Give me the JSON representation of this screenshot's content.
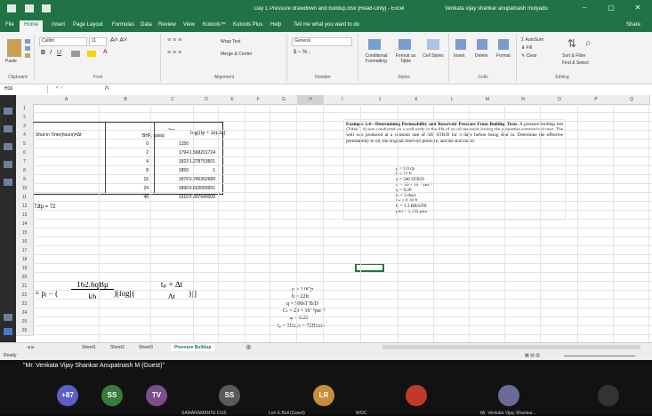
{
  "app": {
    "title": "Day 1 Pressure drawdown and buildup.xlsx [Read-Only] - Excel",
    "user": "Venkata vijay shankar anupatnash mulyadu"
  },
  "ribbon_tabs": [
    "File",
    "Home",
    "Insert",
    "Page Layout",
    "Formulas",
    "Data",
    "Review",
    "View",
    "Kutools™",
    "Kutools Plus",
    "Help",
    "Tell me what you want to do"
  ],
  "share": "Share",
  "ribbon": {
    "clipboard": {
      "label": "Clipboard",
      "paste": "Paste"
    },
    "font": {
      "label": "Font",
      "name": "Calibri",
      "size": "11"
    },
    "alignment": {
      "label": "Alignment",
      "wrap": "Wrap Text",
      "merge": "Merge & Center"
    },
    "number": {
      "label": "Number",
      "format": "General"
    },
    "styles": {
      "label": "Styles",
      "cond": "Conditional Formatting",
      "table": "Format as Table",
      "cell": "Cell Styles"
    },
    "cells": {
      "label": "Cells",
      "insert": "Insert",
      "delete": "Delete",
      "format": "Format"
    },
    "editing": {
      "label": "Editing",
      "autosum": "AutoSum",
      "fill": "Fill",
      "clear": "Clear",
      "sort": "Sort & Filter",
      "find": "Find & Select"
    }
  },
  "formula_bar": {
    "name_box": "H16",
    "fx": "fx"
  },
  "columns": [
    "A",
    "B",
    "C",
    "D",
    "E",
    "F",
    "G",
    "H",
    "I",
    "J",
    "K",
    "L",
    "M",
    "N",
    "O",
    "P",
    "Q"
  ],
  "table": {
    "header_col_a": "Shut-in Time(hours)=Δt",
    "header_col_b_top": "-Pws",
    "header_col_b": "BHP, (psia)",
    "header_col_c": "log[(tp + Δt)/Δt]",
    "rows": [
      {
        "t": "0",
        "p": "1150",
        "log": ""
      },
      {
        "t": "2",
        "p": "1794",
        "log": "1.568201724"
      },
      {
        "t": "4",
        "p": "1823",
        "log": "1.278753601"
      },
      {
        "t": "8",
        "p": "1850",
        "log": "1"
      },
      {
        "t": "16",
        "p": "1876",
        "log": "0.740362689"
      },
      {
        "t": "24",
        "p": "1890",
        "log": "0.602059991"
      },
      {
        "t": "48",
        "p": "1910",
        "log": "0.397940009"
      }
    ]
  },
  "cells": {
    "d3": "72",
    "e3": "tp = 72"
  },
  "given": [
    "μ = 1.0Cp",
    "h = 22ft",
    "q = 500sT B/D",
    "Cₜ = 20 × 10⁻⁶psi⁻¹",
    "φ = 0.20",
    "tₚ = 3Days = 72Hours"
  ],
  "example": {
    "title": "Example 2.4—Determining Permeability and Reservoir Pressure From Buildup Tests.",
    "body": "A pressure-buildup test (Table 2.4) was conducted on a well early in the life of an oil reservoir having the properties summarized next. The well was produced at a constant rate of 500 STB/D for 3 days before being shut in. Determine the effective permeability to oil, the original reservoir pressure, and the skin factor.",
    "props": [
      "μ = 1.0 cp",
      "h = 22 ft",
      "q = 500 STB/D",
      "cₜ = 20 × 10⁻⁶ psi⁻¹",
      "φ = 0.20",
      "tₚ = 3 days",
      "rw = 0.30 ft",
      "B = 1.3 RB/STB",
      "pwf = 1,150 psia"
    ]
  },
  "formula": {
    "lhs": "Pws = pᵢ − (",
    "num": "162.6qBμ",
    "den": "kh",
    "mid": ")[log[(",
    "num2": "tₚ + Δt",
    "den2": "Δt",
    "end": ")]]"
  },
  "sheets": [
    "Sheet1",
    "Sheet2",
    "Sheet3",
    "Pressure Buildup"
  ],
  "status": {
    "ready": "Ready"
  },
  "meeting": {
    "presenter_label": "\"Mr. Venkata Vijay Shankar Anupatnash M (Guest)\"",
    "avatars": [
      {
        "text": "+87",
        "color": "#5b5fc7"
      },
      {
        "text": "SS",
        "color": "#3a7a3a"
      },
      {
        "text": "TV",
        "color": "#7a4f8a"
      },
      {
        "text": "SS",
        "color": "#5a5a5a"
      },
      {
        "text": "LR",
        "color": "#c78d3a"
      },
      {
        "text": "",
        "color": "#c0392b"
      },
      {
        "text": "",
        "color": "#6b6b9a"
      },
      {
        "text": "",
        "color": "#333333"
      }
    ],
    "names": [
      "SAMARAMANTE DUS",
      "Lori E.Bull (Guest)",
      "WOC",
      "Mr. Venkata Vijay Shankar..."
    ]
  },
  "colors": {
    "excel_green": "#217346"
  }
}
